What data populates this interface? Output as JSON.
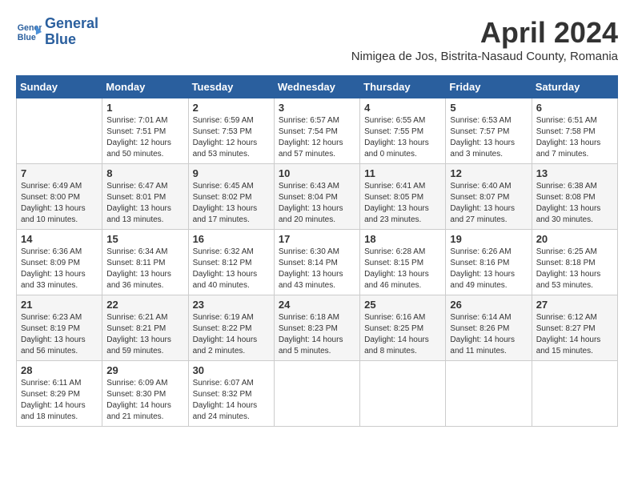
{
  "header": {
    "logo_line1": "General",
    "logo_line2": "Blue",
    "title": "April 2024",
    "subtitle": "Nimigea de Jos, Bistrita-Nasaud County, Romania"
  },
  "weekdays": [
    "Sunday",
    "Monday",
    "Tuesday",
    "Wednesday",
    "Thursday",
    "Friday",
    "Saturday"
  ],
  "weeks": [
    [
      {
        "day": "",
        "sunrise": "",
        "sunset": "",
        "daylight": ""
      },
      {
        "day": "1",
        "sunrise": "Sunrise: 7:01 AM",
        "sunset": "Sunset: 7:51 PM",
        "daylight": "Daylight: 12 hours and 50 minutes."
      },
      {
        "day": "2",
        "sunrise": "Sunrise: 6:59 AM",
        "sunset": "Sunset: 7:53 PM",
        "daylight": "Daylight: 12 hours and 53 minutes."
      },
      {
        "day": "3",
        "sunrise": "Sunrise: 6:57 AM",
        "sunset": "Sunset: 7:54 PM",
        "daylight": "Daylight: 12 hours and 57 minutes."
      },
      {
        "day": "4",
        "sunrise": "Sunrise: 6:55 AM",
        "sunset": "Sunset: 7:55 PM",
        "daylight": "Daylight: 13 hours and 0 minutes."
      },
      {
        "day": "5",
        "sunrise": "Sunrise: 6:53 AM",
        "sunset": "Sunset: 7:57 PM",
        "daylight": "Daylight: 13 hours and 3 minutes."
      },
      {
        "day": "6",
        "sunrise": "Sunrise: 6:51 AM",
        "sunset": "Sunset: 7:58 PM",
        "daylight": "Daylight: 13 hours and 7 minutes."
      }
    ],
    [
      {
        "day": "7",
        "sunrise": "Sunrise: 6:49 AM",
        "sunset": "Sunset: 8:00 PM",
        "daylight": "Daylight: 13 hours and 10 minutes."
      },
      {
        "day": "8",
        "sunrise": "Sunrise: 6:47 AM",
        "sunset": "Sunset: 8:01 PM",
        "daylight": "Daylight: 13 hours and 13 minutes."
      },
      {
        "day": "9",
        "sunrise": "Sunrise: 6:45 AM",
        "sunset": "Sunset: 8:02 PM",
        "daylight": "Daylight: 13 hours and 17 minutes."
      },
      {
        "day": "10",
        "sunrise": "Sunrise: 6:43 AM",
        "sunset": "Sunset: 8:04 PM",
        "daylight": "Daylight: 13 hours and 20 minutes."
      },
      {
        "day": "11",
        "sunrise": "Sunrise: 6:41 AM",
        "sunset": "Sunset: 8:05 PM",
        "daylight": "Daylight: 13 hours and 23 minutes."
      },
      {
        "day": "12",
        "sunrise": "Sunrise: 6:40 AM",
        "sunset": "Sunset: 8:07 PM",
        "daylight": "Daylight: 13 hours and 27 minutes."
      },
      {
        "day": "13",
        "sunrise": "Sunrise: 6:38 AM",
        "sunset": "Sunset: 8:08 PM",
        "daylight": "Daylight: 13 hours and 30 minutes."
      }
    ],
    [
      {
        "day": "14",
        "sunrise": "Sunrise: 6:36 AM",
        "sunset": "Sunset: 8:09 PM",
        "daylight": "Daylight: 13 hours and 33 minutes."
      },
      {
        "day": "15",
        "sunrise": "Sunrise: 6:34 AM",
        "sunset": "Sunset: 8:11 PM",
        "daylight": "Daylight: 13 hours and 36 minutes."
      },
      {
        "day": "16",
        "sunrise": "Sunrise: 6:32 AM",
        "sunset": "Sunset: 8:12 PM",
        "daylight": "Daylight: 13 hours and 40 minutes."
      },
      {
        "day": "17",
        "sunrise": "Sunrise: 6:30 AM",
        "sunset": "Sunset: 8:14 PM",
        "daylight": "Daylight: 13 hours and 43 minutes."
      },
      {
        "day": "18",
        "sunrise": "Sunrise: 6:28 AM",
        "sunset": "Sunset: 8:15 PM",
        "daylight": "Daylight: 13 hours and 46 minutes."
      },
      {
        "day": "19",
        "sunrise": "Sunrise: 6:26 AM",
        "sunset": "Sunset: 8:16 PM",
        "daylight": "Daylight: 13 hours and 49 minutes."
      },
      {
        "day": "20",
        "sunrise": "Sunrise: 6:25 AM",
        "sunset": "Sunset: 8:18 PM",
        "daylight": "Daylight: 13 hours and 53 minutes."
      }
    ],
    [
      {
        "day": "21",
        "sunrise": "Sunrise: 6:23 AM",
        "sunset": "Sunset: 8:19 PM",
        "daylight": "Daylight: 13 hours and 56 minutes."
      },
      {
        "day": "22",
        "sunrise": "Sunrise: 6:21 AM",
        "sunset": "Sunset: 8:21 PM",
        "daylight": "Daylight: 13 hours and 59 minutes."
      },
      {
        "day": "23",
        "sunrise": "Sunrise: 6:19 AM",
        "sunset": "Sunset: 8:22 PM",
        "daylight": "Daylight: 14 hours and 2 minutes."
      },
      {
        "day": "24",
        "sunrise": "Sunrise: 6:18 AM",
        "sunset": "Sunset: 8:23 PM",
        "daylight": "Daylight: 14 hours and 5 minutes."
      },
      {
        "day": "25",
        "sunrise": "Sunrise: 6:16 AM",
        "sunset": "Sunset: 8:25 PM",
        "daylight": "Daylight: 14 hours and 8 minutes."
      },
      {
        "day": "26",
        "sunrise": "Sunrise: 6:14 AM",
        "sunset": "Sunset: 8:26 PM",
        "daylight": "Daylight: 14 hours and 11 minutes."
      },
      {
        "day": "27",
        "sunrise": "Sunrise: 6:12 AM",
        "sunset": "Sunset: 8:27 PM",
        "daylight": "Daylight: 14 hours and 15 minutes."
      }
    ],
    [
      {
        "day": "28",
        "sunrise": "Sunrise: 6:11 AM",
        "sunset": "Sunset: 8:29 PM",
        "daylight": "Daylight: 14 hours and 18 minutes."
      },
      {
        "day": "29",
        "sunrise": "Sunrise: 6:09 AM",
        "sunset": "Sunset: 8:30 PM",
        "daylight": "Daylight: 14 hours and 21 minutes."
      },
      {
        "day": "30",
        "sunrise": "Sunrise: 6:07 AM",
        "sunset": "Sunset: 8:32 PM",
        "daylight": "Daylight: 14 hours and 24 minutes."
      },
      {
        "day": "",
        "sunrise": "",
        "sunset": "",
        "daylight": ""
      },
      {
        "day": "",
        "sunrise": "",
        "sunset": "",
        "daylight": ""
      },
      {
        "day": "",
        "sunrise": "",
        "sunset": "",
        "daylight": ""
      },
      {
        "day": "",
        "sunrise": "",
        "sunset": "",
        "daylight": ""
      }
    ]
  ]
}
